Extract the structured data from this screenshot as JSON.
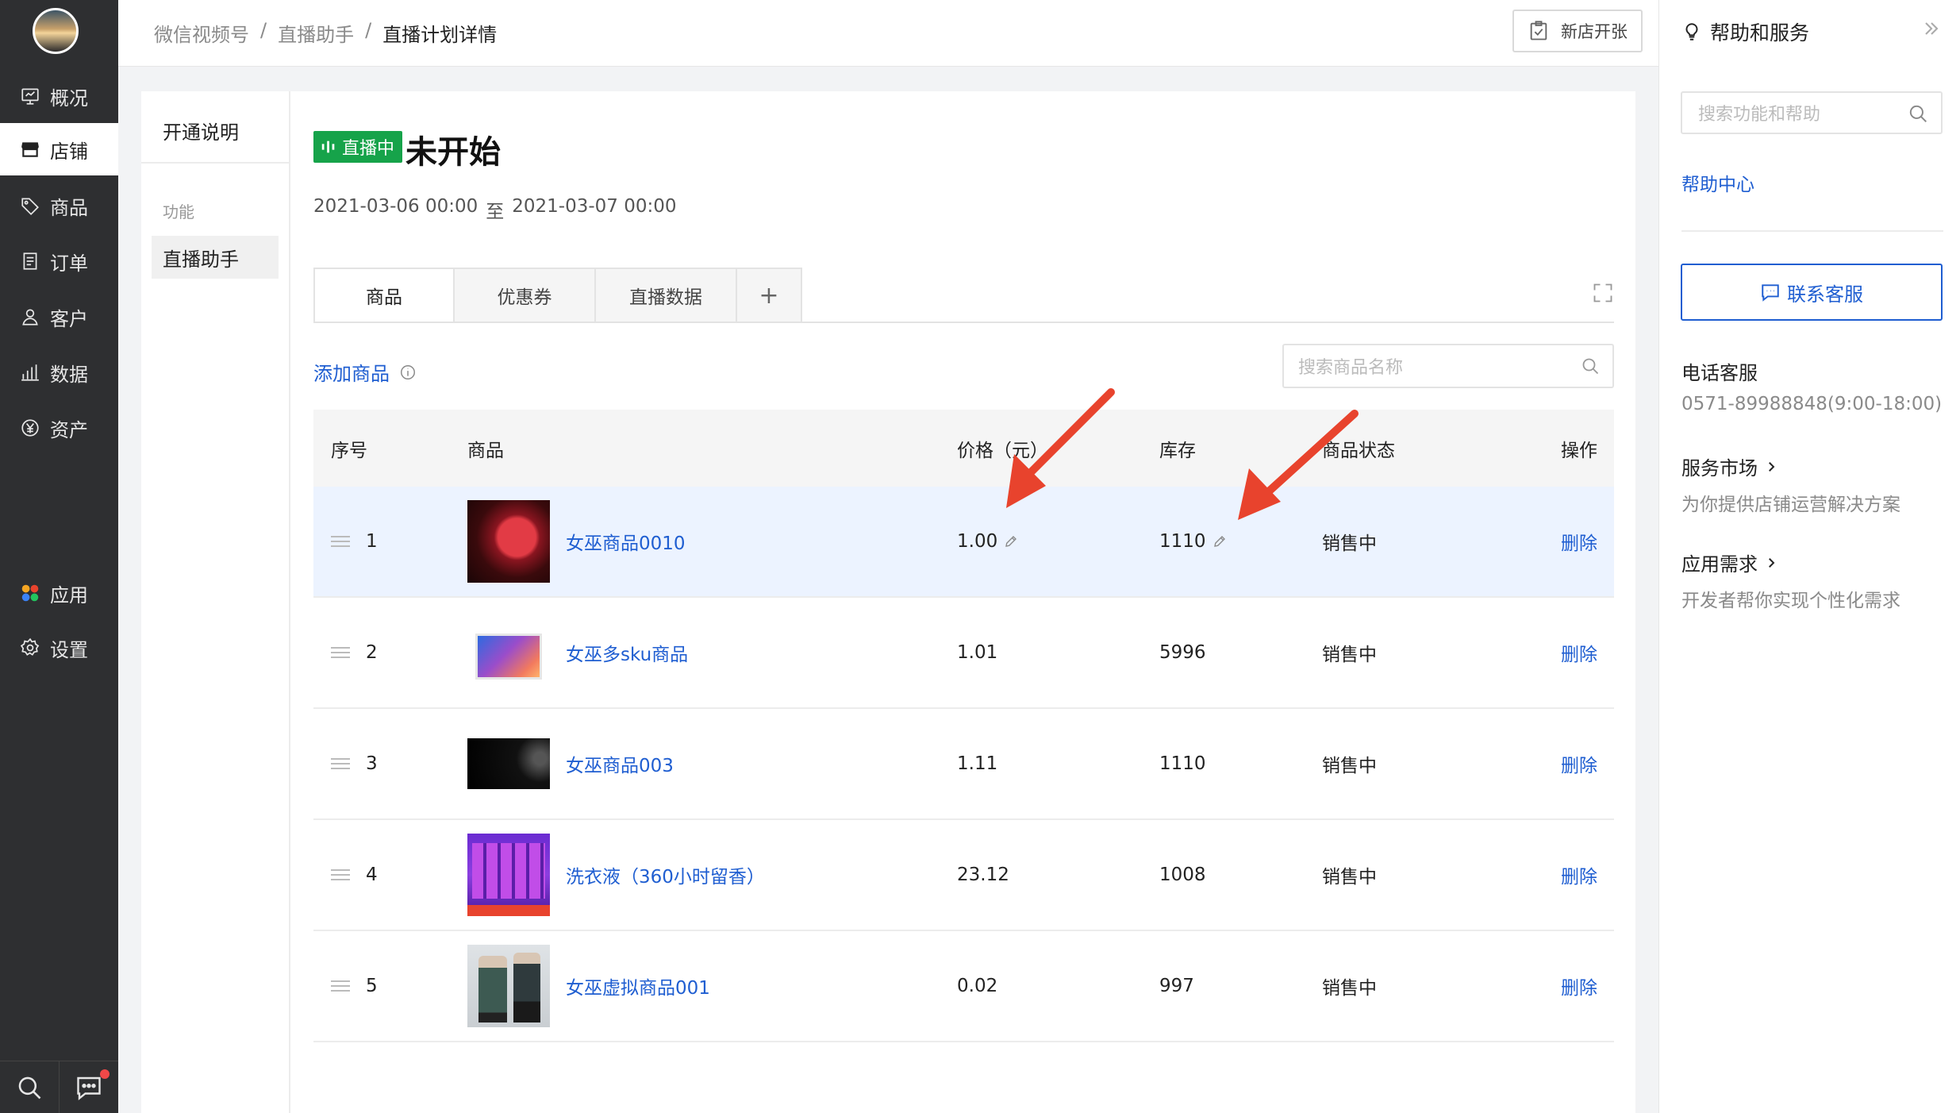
{
  "nav": {
    "items": [
      {
        "label": "概况",
        "icon": "monitor-icon"
      },
      {
        "label": "店铺",
        "icon": "store-icon"
      },
      {
        "label": "商品",
        "icon": "tag-icon"
      },
      {
        "label": "订单",
        "icon": "document-icon"
      },
      {
        "label": "客户",
        "icon": "user-icon"
      },
      {
        "label": "数据",
        "icon": "bar-chart-icon"
      },
      {
        "label": "资产",
        "icon": "yen-icon"
      },
      {
        "label": "应用",
        "icon": "apps-icon"
      },
      {
        "label": "设置",
        "icon": "gear-icon"
      }
    ],
    "active": "店铺"
  },
  "breadcrumb": {
    "items": [
      "微信视频号",
      "/",
      "直播助手",
      "/",
      "直播计划详情"
    ]
  },
  "topbar": {
    "new_store_label": "新店开张"
  },
  "subnav": {
    "open_guide": "开通说明",
    "section_label": "功能",
    "item": "直播助手"
  },
  "plan": {
    "status_badge": "直播中",
    "title": "未开始",
    "start": "2021-03-06 00:00",
    "separator": "至",
    "end": "2021-03-07 00:00"
  },
  "tabs": [
    "商品",
    "优惠券",
    "直播数据",
    "+"
  ],
  "products_panel": {
    "add_label": "添加商品",
    "search_placeholder": "搜索商品名称"
  },
  "table": {
    "headers": [
      "序号",
      "商品",
      "价格（元）",
      "库存",
      "商品状态",
      "操作"
    ],
    "rows": [
      {
        "idx": "1",
        "name": "女巫商品0010",
        "price": "1.00",
        "stock": "1110",
        "status": "销售中",
        "op": "删除"
      },
      {
        "idx": "2",
        "name": "女巫多sku商品",
        "price": "1.01",
        "stock": "5996",
        "status": "销售中",
        "op": "删除"
      },
      {
        "idx": "3",
        "name": "女巫商品003",
        "price": "1.11",
        "stock": "1110",
        "status": "销售中",
        "op": "删除"
      },
      {
        "idx": "4",
        "name": "洗衣液（360小时留香）",
        "price": "23.12",
        "stock": "1008",
        "status": "销售中",
        "op": "删除"
      },
      {
        "idx": "5",
        "name": "女巫虚拟商品001",
        "price": "0.02",
        "stock": "997",
        "status": "销售中",
        "op": "删除"
      }
    ]
  },
  "help": {
    "title": "帮助和服务",
    "search_placeholder": "搜索功能和帮助",
    "help_center": "帮助中心",
    "contact_button": "联系客服",
    "phone_title": "电话客服",
    "phone": "0571-89988848(9:00-18:00)",
    "market_title": "服务市场",
    "market_desc": "为你提供店铺运营解决方案",
    "app_title": "应用需求",
    "app_desc": "开发者帮你实现个性化需求"
  },
  "colors": {
    "accent": "#1f5ed1",
    "badge_green": "#16a34a",
    "nav_bg": "#2e2f31",
    "arrow_red": "#e8432d"
  }
}
